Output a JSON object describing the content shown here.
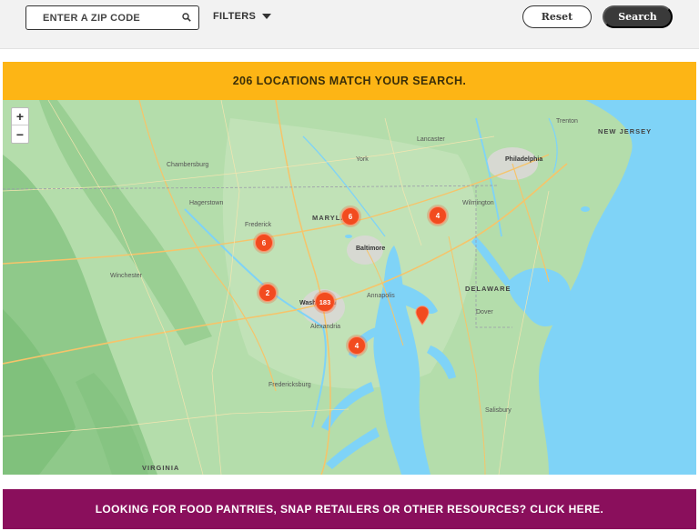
{
  "search": {
    "zip_placeholder": "ENTER A ZIP CODE",
    "filters_label": "FILTERS",
    "reset_label": "Reset",
    "search_label": "Search"
  },
  "results": {
    "banner_text": "206 LOCATIONS MATCH YOUR SEARCH."
  },
  "map": {
    "zoom_in": "+",
    "zoom_out": "−",
    "clusters": [
      {
        "count": "6"
      },
      {
        "count": "4"
      },
      {
        "count": "6"
      },
      {
        "count": "2"
      },
      {
        "count": "183"
      },
      {
        "count": "4"
      }
    ],
    "labels": {
      "philadelphia": "Philadelphia",
      "baltimore": "Baltimore",
      "washington": "Washington",
      "trenton": "Trenton",
      "new_jersey": "NEW JERSEY",
      "maryland": "MARYLAND",
      "delaware": "DELAWARE",
      "virginia": "VIRGINIA",
      "chambersburg": "Chambersburg",
      "hagerstown": "Hagerstown",
      "frederick": "Frederick",
      "dover": "Dover",
      "annapolis": "Annapolis",
      "wilmington": "Wilmington",
      "lancaster": "Lancaster",
      "york": "York",
      "salisbury": "Salisbury",
      "alexandria": "Alexandria",
      "fredericksburg": "Fredericksburg",
      "winchester": "Winchester"
    },
    "colors": {
      "land": "#a9d8a0",
      "forest": "#8fca8a",
      "water": "#7fd3f7",
      "cluster": "#f24b1f"
    }
  },
  "footer": {
    "resources_text": "LOOKING FOR FOOD PANTRIES, SNAP RETAILERS OR OTHER RESOURCES? CLICK HERE."
  }
}
